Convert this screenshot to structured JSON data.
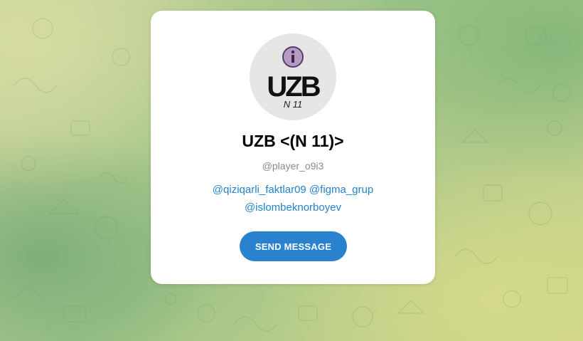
{
  "profile": {
    "avatar_text": "UZB",
    "avatar_subtext": "N 11",
    "avatar_icon": "info-icon",
    "title": "UZB <(N 11)>",
    "username": "@player_o9i3",
    "bio_links": [
      "@qiziqarli_faktlar09",
      "@figma_grup",
      "@islombeknorboyev"
    ]
  },
  "actions": {
    "send_label": "SEND MESSAGE"
  },
  "colors": {
    "accent": "#2a82ce",
    "link": "#2481cc",
    "muted": "#8a8a8a"
  }
}
